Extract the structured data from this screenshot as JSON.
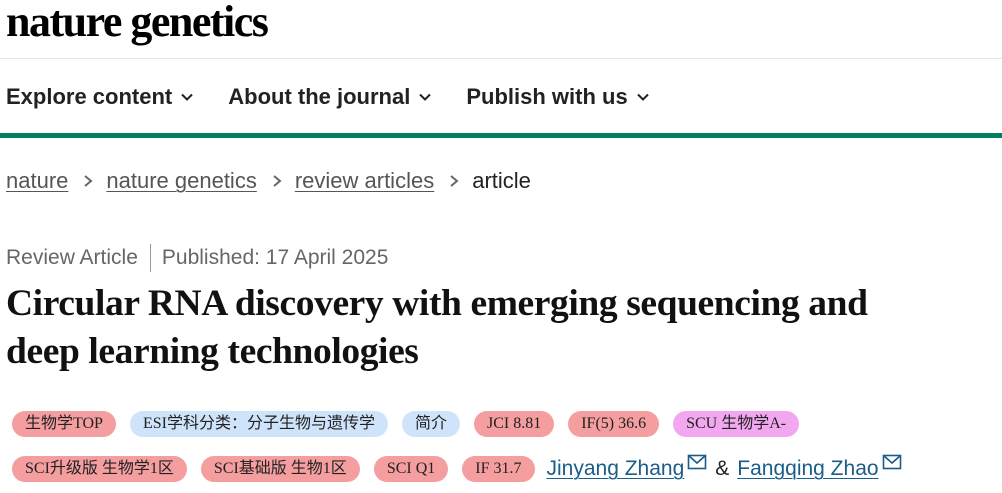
{
  "brand": {
    "logo_text": "nature genetics"
  },
  "nav": {
    "items": [
      {
        "label": "Explore content"
      },
      {
        "label": "About the journal"
      },
      {
        "label": "Publish with us"
      }
    ],
    "accent_color": "#00805f"
  },
  "breadcrumb": {
    "items": [
      {
        "label": "nature"
      },
      {
        "label": "nature genetics"
      },
      {
        "label": "review articles"
      },
      {
        "label": "article"
      }
    ]
  },
  "article": {
    "type": "Review Article",
    "published": "Published: 17 April 2025",
    "title_line1": "Circular RNA discovery with emerging sequencing and",
    "title_line2": "deep learning technologies"
  },
  "badges": {
    "row1": [
      {
        "label": "生物学TOP",
        "color": "#f59ea0"
      },
      {
        "label": "ESI学科分类：分子生物与遗传学",
        "color": "#cfe3fa"
      },
      {
        "label": "简介",
        "color": "#cfe3fa"
      },
      {
        "label": "JCI 8.81",
        "color": "#f59ea0"
      },
      {
        "label": "IF(5) 36.6",
        "color": "#f59ea0"
      },
      {
        "label": "SCU 生物学A-",
        "color": "#f2a8f0"
      }
    ],
    "row2": [
      {
        "label": "SCI升级版 生物学1区",
        "color": "#f59ea0"
      },
      {
        "label": "SCI基础版 生物1区",
        "color": "#f59ea0"
      },
      {
        "label": "SCI Q1",
        "color": "#f59ea0"
      },
      {
        "label": "IF 31.7",
        "color": "#f59ea0"
      }
    ]
  },
  "authors": {
    "list": [
      {
        "name": "Jinyang Zhang",
        "icon": "mail-icon"
      },
      {
        "name": "Fangqing Zhao",
        "icon": "mail-icon"
      }
    ],
    "separator": "&",
    "link_color": "#1a5d8a"
  }
}
